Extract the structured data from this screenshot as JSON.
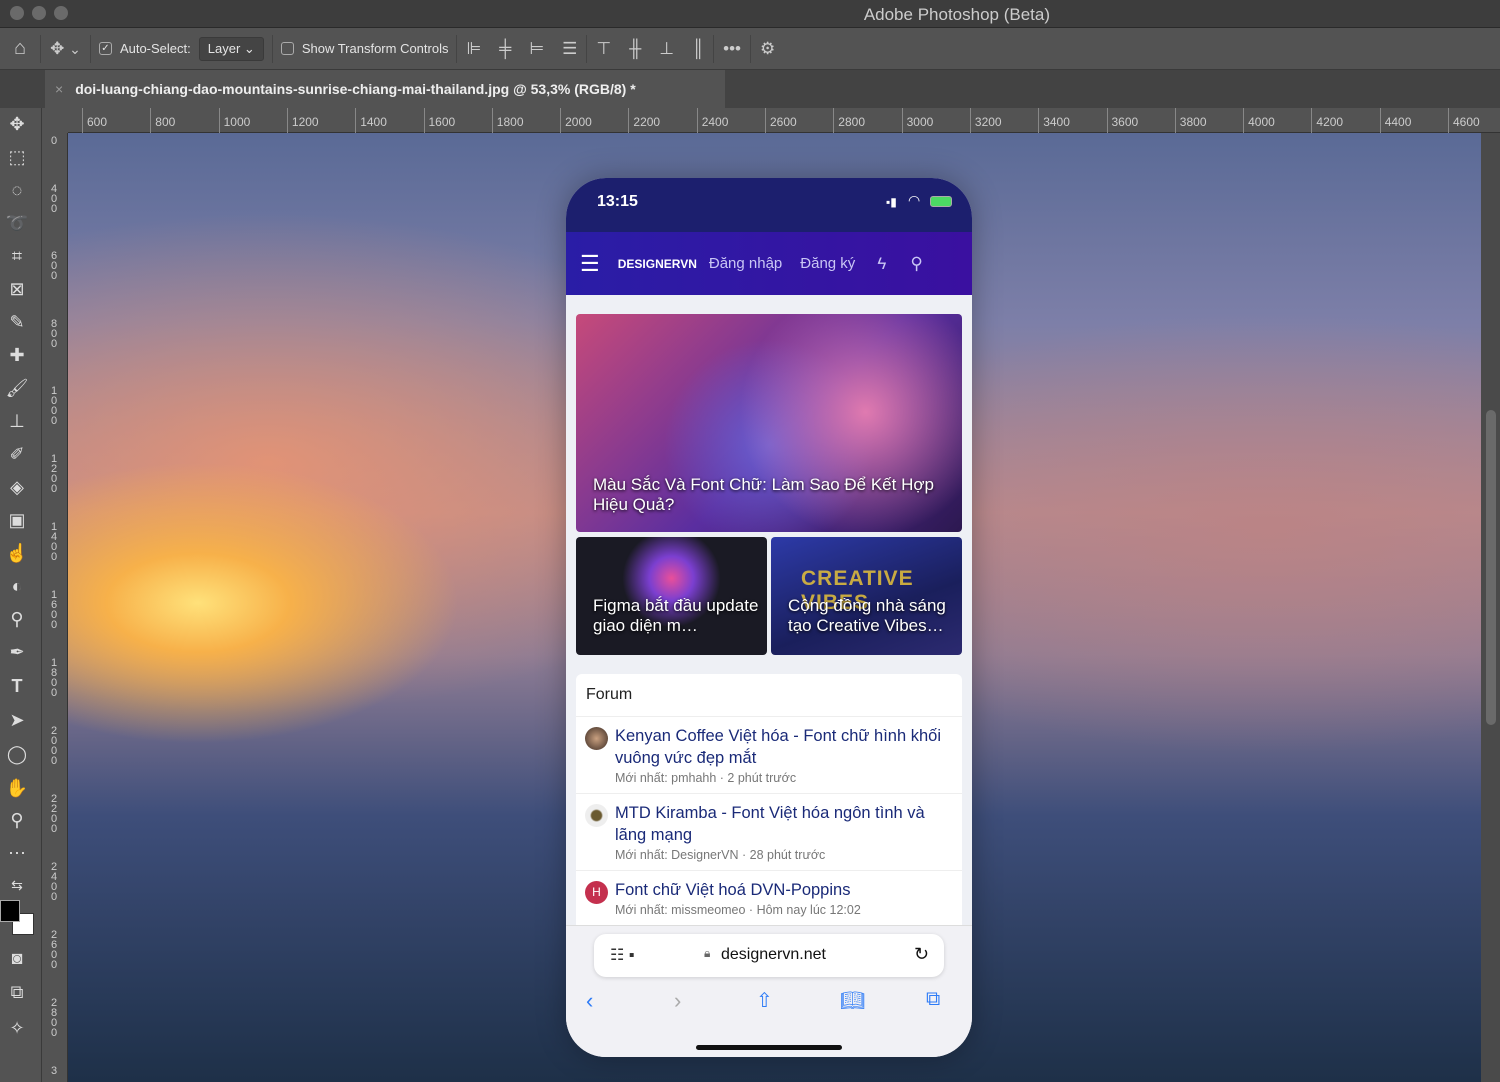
{
  "app": {
    "title": "Adobe Photoshop (Beta)"
  },
  "options": {
    "auto_select_label": "Auto-Select:",
    "auto_select_checked": true,
    "layer_select": "Layer",
    "show_transform_label": "Show Transform Controls",
    "show_transform_checked": false,
    "more": "•••"
  },
  "document": {
    "tab_title": "doi-luang-chiang-dao-mountains-sunrise-chiang-mai-thailand.jpg @ 53,3% (RGB/8) *",
    "close": "×"
  },
  "ruler": {
    "h_ticks": [
      "600",
      "800",
      "1000",
      "1200",
      "1400",
      "1600",
      "1800",
      "2000",
      "2200",
      "2400",
      "2600",
      "2800",
      "3000",
      "3200",
      "3400",
      "3600",
      "3800",
      "4000",
      "4200",
      "4400",
      "4600"
    ],
    "v_ticks": [
      "0",
      "400",
      "600",
      "800",
      "1000",
      "1200",
      "1400",
      "1600",
      "1800",
      "2000",
      "2200",
      "2400",
      "2600",
      "2800",
      "3"
    ]
  },
  "phone": {
    "status": {
      "time": "13:15"
    },
    "nav": {
      "logo": "DESIGNERVN",
      "login": "Đăng nhập",
      "register": "Đăng ký"
    },
    "hero": {
      "title": "Màu Sắc Và Font Chữ: Làm Sao Để Kết Hợp Hiệu Quả?"
    },
    "cards": [
      {
        "title": "Figma bắt đầu update giao diện m…"
      },
      {
        "title": "Cộng đồng nhà sáng tạo Creative Vibes…",
        "art_text": "CREATIVE VIBES"
      }
    ],
    "forum": {
      "heading": "Forum",
      "items": [
        {
          "title": "Kenyan Coffee Việt hóa - Font chữ hình khối vuông vức đẹp mắt",
          "meta": "Mới nhất: pmhahh · 2 phút trước"
        },
        {
          "title": "MTD Kiramba - Font Việt hóa ngôn tình và lãng mạng",
          "meta": "Mới nhất: DesignerVN · 28 phút trước"
        },
        {
          "title": "Font chữ Việt hoá DVN-Poppins",
          "meta": "Mới nhất: missmeomeo · Hôm nay lúc 12:02",
          "avatar_letter": "H"
        }
      ]
    },
    "safari": {
      "url": "designervn.net"
    }
  },
  "colors": {
    "nav": "#2a1da6",
    "status": "#1c1f6e",
    "link": "#1a2a78",
    "safari_accent": "#2f7cf6"
  }
}
